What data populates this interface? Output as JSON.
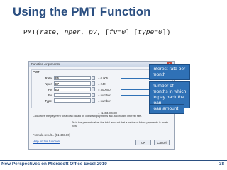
{
  "slide": {
    "title": "Using the PMT Function",
    "syntax": {
      "func": "PMT(",
      "rate": "rate",
      "sep1": ", ",
      "nper": "nper",
      "sep2": ", ",
      "pv": "pv",
      "sep3": ", [",
      "fv": "fv=0",
      "sep4": "] [",
      "type": "type=0",
      "close": "])"
    }
  },
  "dialog": {
    "title": "Function Arguments",
    "close_label": "x",
    "function_name": "PMT",
    "args": [
      {
        "label": "Rate",
        "value": "B5",
        "evaluated": "= 0.005"
      },
      {
        "label": "Nper",
        "value": "B7",
        "evaluated": "= 240"
      },
      {
        "label": "Pv",
        "value": "B3",
        "evaluated": "= 300000"
      },
      {
        "label": "Fv",
        "value": "",
        "evaluated": "= number"
      },
      {
        "label": "Type",
        "value": "",
        "evaluated": "= number"
      }
    ],
    "result_preview": "= -1403.80339",
    "description": "Calculates the payment for a loan based on constant payments and a constant interest rate.",
    "arg_description": "Pv  is the present value: the total amount that a series of future payments is worth now.",
    "formula_result": "Formula result = ($1,403.80)",
    "help_link": "Help on this function",
    "ok_label": "OK",
    "cancel_label": "Cancel"
  },
  "callouts": {
    "interest": "interest rate per month",
    "months": "number of months in which to pay back the loan",
    "loan": "loan amount"
  },
  "footer": {
    "text": "New Perspectives on Microsoft Office Excel 2010",
    "page": "38"
  },
  "colors": {
    "title": "#2b4f81",
    "callout_fill": "#2f71b6"
  }
}
